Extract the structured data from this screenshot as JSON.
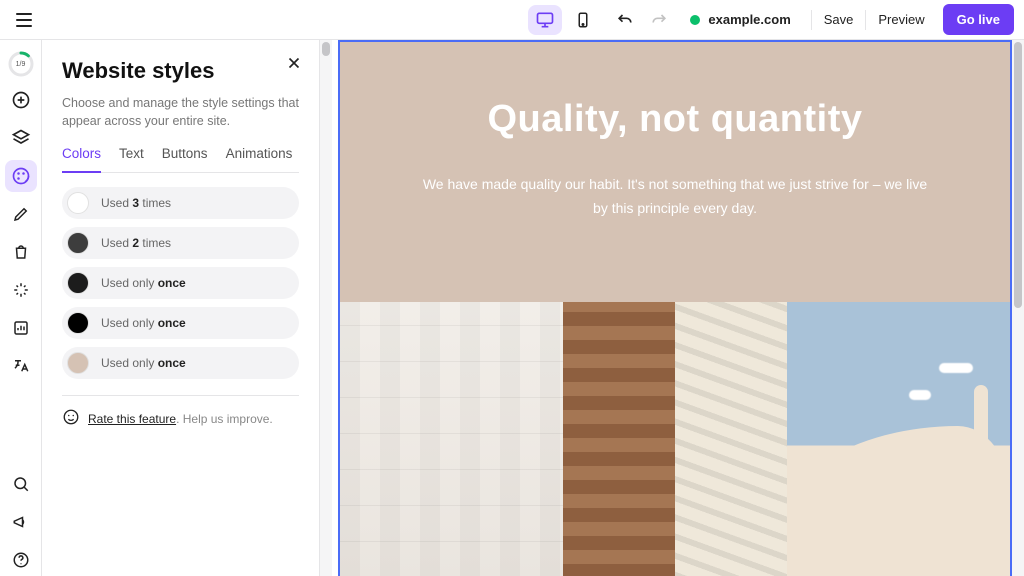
{
  "header": {
    "site_name": "example.com",
    "save_label": "Save",
    "preview_label": "Preview",
    "cta_label": "Go live"
  },
  "progress": {
    "label": "1/9"
  },
  "panel": {
    "title": "Website styles",
    "description": "Choose and manage the style settings that appear across your entire site.",
    "tabs": {
      "colors": "Colors",
      "text": "Text",
      "buttons": "Buttons",
      "animations": "Animations"
    },
    "colors": [
      {
        "hex": "#ffffff",
        "label_pre": "Used ",
        "label_bold": "3",
        "label_post": " times"
      },
      {
        "hex": "#3d3d3d",
        "label_pre": "Used ",
        "label_bold": "2",
        "label_post": " times"
      },
      {
        "hex": "#1c1c1c",
        "label_pre": "Used only ",
        "label_bold": "once",
        "label_post": ""
      },
      {
        "hex": "#000000",
        "label_pre": "Used only ",
        "label_bold": "once",
        "label_post": ""
      },
      {
        "hex": "#d5c2b4",
        "label_pre": "Used only ",
        "label_bold": "once",
        "label_post": ""
      }
    ],
    "rate_link": "Rate this feature",
    "rate_tail": ". Help us improve."
  },
  "canvas": {
    "headline": "Quality, not quantity",
    "subtext": "We have made quality our habit. It's not something that we just strive for – we live by this principle every day."
  }
}
